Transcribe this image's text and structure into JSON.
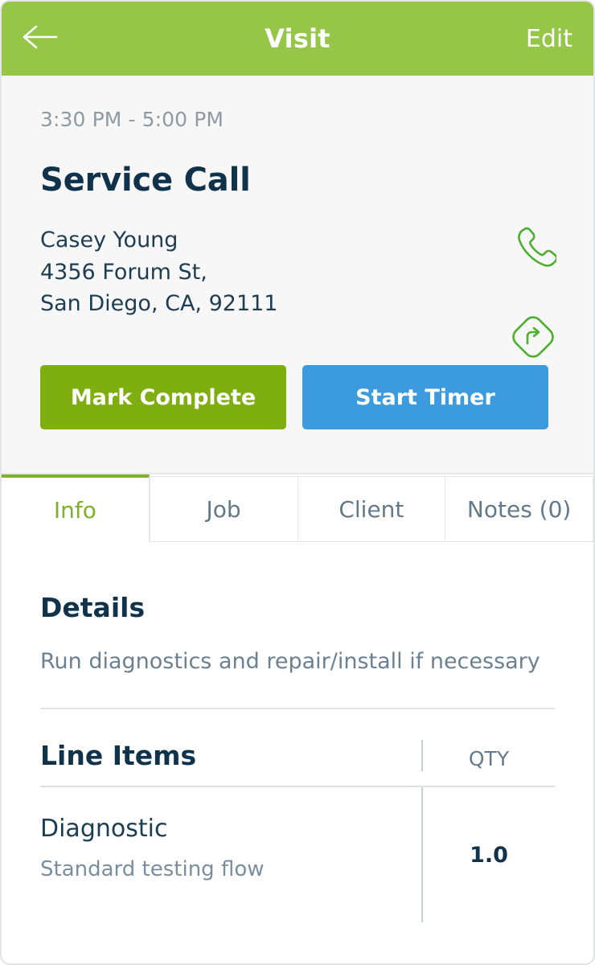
{
  "appbar": {
    "back_icon": "arrow-left-icon",
    "title": "Visit",
    "edit_label": "Edit",
    "background_color": "#95c648",
    "text_color": "#ffffff"
  },
  "summary": {
    "time_range": "3:30 PM - 5:00 PM",
    "visit_title": "Service Call",
    "client_name": "Casey Young",
    "address_line1": "4356 Forum St,",
    "address_line2": "San Diego, CA, 92111",
    "call_icon": "phone-icon",
    "directions_icon": "navigate-arrow-icon",
    "icon_color": "#4caf2e",
    "actions": {
      "complete_label": "Mark Complete",
      "complete_color": "#7fae10",
      "timer_label": "Start Timer",
      "timer_color": "#3c9bde"
    }
  },
  "tabs": {
    "active_index": 0,
    "active_color": "#7fb02a",
    "items": [
      {
        "label": "Info"
      },
      {
        "label": "Job"
      },
      {
        "label": "Client"
      },
      {
        "label": "Notes (0)"
      }
    ]
  },
  "details": {
    "heading": "Details",
    "text": "Run diagnostics and repair/install if necessary"
  },
  "line_items": {
    "heading": "Line Items",
    "qty_header": "QTY",
    "rows": [
      {
        "name": "Diagnostic",
        "description": "Standard testing flow",
        "qty": "1.0"
      }
    ]
  }
}
